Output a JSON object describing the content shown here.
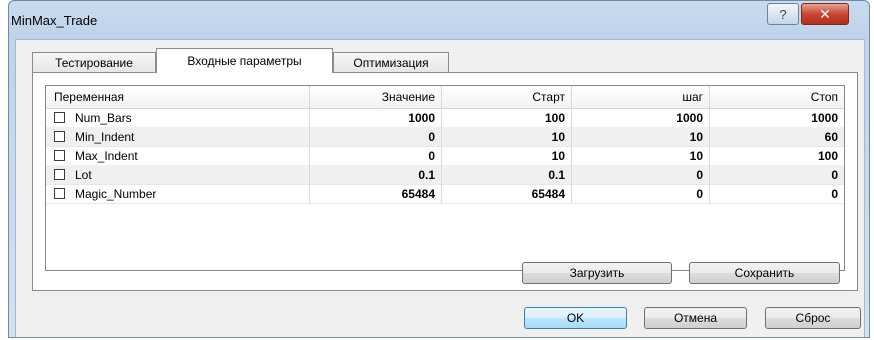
{
  "window": {
    "title": "MinMax_Trade",
    "help_label": "?",
    "close_label": "✕"
  },
  "tabs": [
    {
      "label": "Тестирование",
      "active": false
    },
    {
      "label": "Входные параметры",
      "active": true
    },
    {
      "label": "Оптимизация",
      "active": false
    }
  ],
  "table": {
    "columns": [
      "Переменная",
      "Значение",
      "Старт",
      "шаг",
      "Стоп"
    ],
    "rows": [
      {
        "name": "Num_Bars",
        "value": "1000",
        "start": "100",
        "step": "1000",
        "stop": "1000",
        "checked": false
      },
      {
        "name": "Min_Indent",
        "value": "0",
        "start": "10",
        "step": "10",
        "stop": "60",
        "checked": false
      },
      {
        "name": "Max_Indent",
        "value": "0",
        "start": "10",
        "step": "10",
        "stop": "100",
        "checked": false
      },
      {
        "name": "Lot",
        "value": "0.1",
        "start": "0.1",
        "step": "0",
        "stop": "0",
        "checked": false
      },
      {
        "name": "Magic_Number",
        "value": "65484",
        "start": "65484",
        "step": "0",
        "stop": "0",
        "checked": false
      }
    ]
  },
  "buttons": {
    "load": "Загрузить",
    "save": "Сохранить",
    "ok": "OK",
    "cancel": "Отмена",
    "reset": "Сброс"
  }
}
